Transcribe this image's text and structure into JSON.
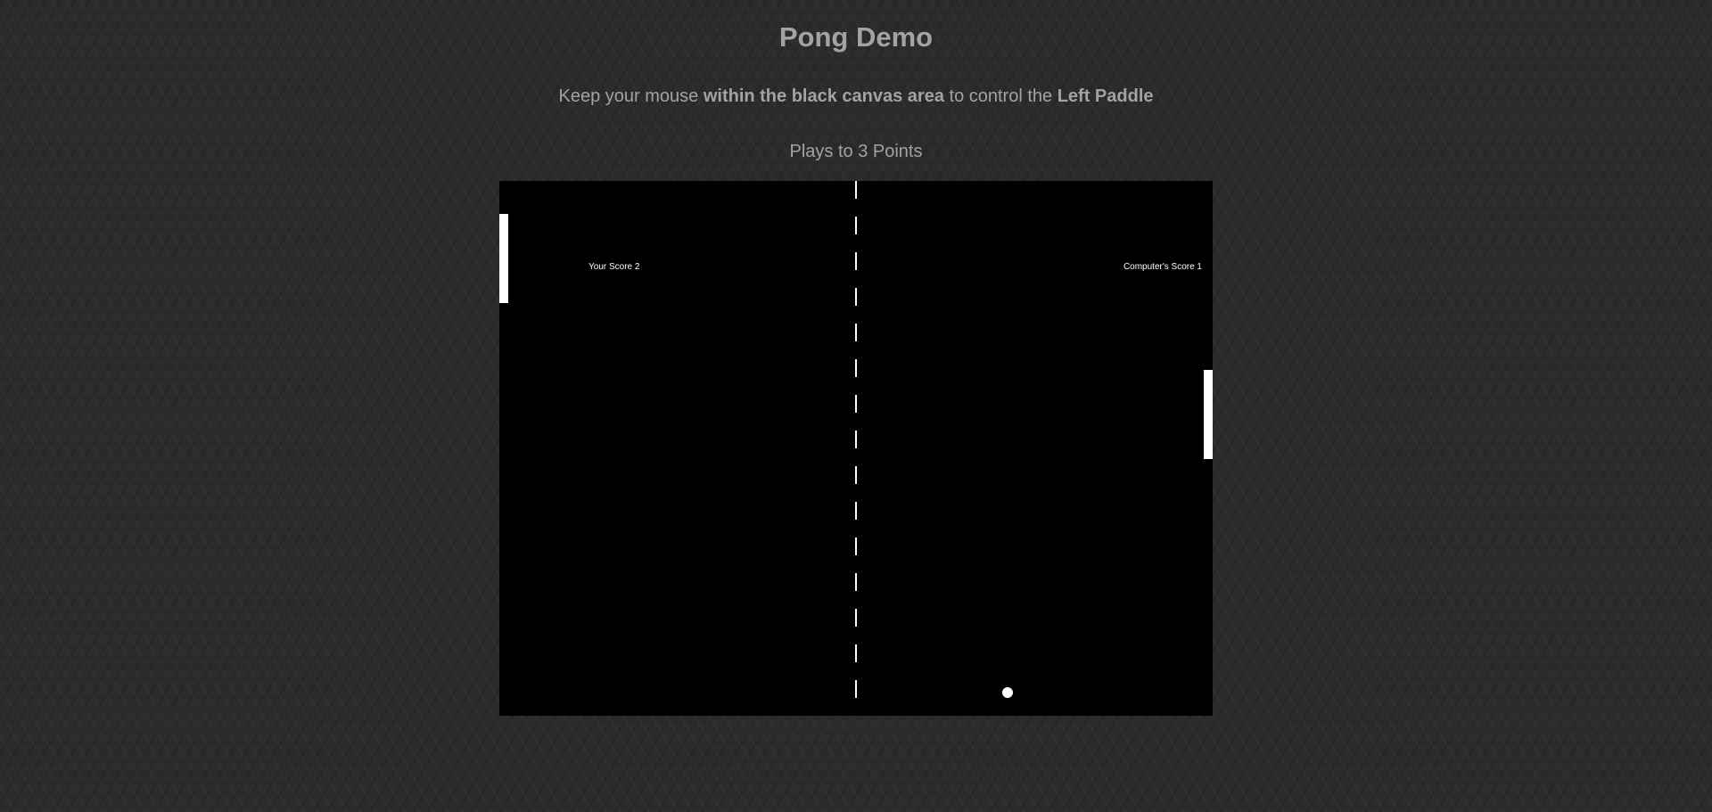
{
  "header": {
    "title": "Pong Demo"
  },
  "instructions": {
    "part1": "Keep your mouse ",
    "bold1": "within the black canvas area",
    "part2": " to control the ",
    "bold2": "Left Paddle"
  },
  "rules": {
    "plays_to": "Plays to 3 Points"
  },
  "game": {
    "player_score_text": "Your Score 2",
    "computer_score_text": "Computer's Score 1",
    "player_score": 2,
    "computer_score": 1,
    "target_points": 3,
    "colors": {
      "canvas": "#000000",
      "foreground": "#ffffff",
      "page_background": "#2b2b2b",
      "text": "#a3a3a3"
    }
  }
}
